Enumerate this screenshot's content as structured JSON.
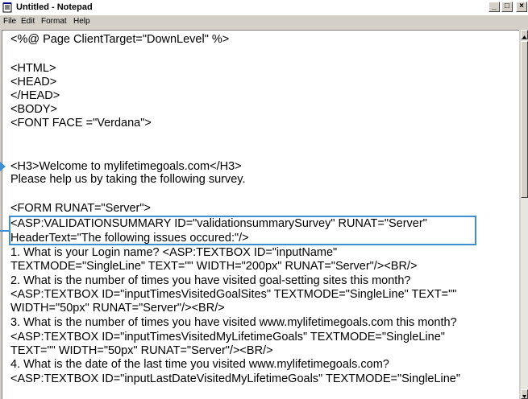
{
  "window": {
    "title": "Untitled - Notepad",
    "controls": {
      "minimize": "_",
      "maximize": "□",
      "close": "×"
    }
  },
  "menu": [
    "File",
    "Edit",
    "Format",
    "Help"
  ],
  "editor": {
    "lines": [
      "<%@ Page ClientTarget=\"DownLevel\" %>",
      "",
      "<HTML>",
      "<HEAD>",
      "</HEAD>",
      "<BODY>",
      "<FONT FACE =\"Verdana\">",
      "",
      "<H3>Welcome to mylifetimegoals.com</H3>",
      "Please help us by taking the following survey.",
      "",
      "<FORM RUNAT=\"Server\">",
      "<ASP:VALIDATIONSUMMARY ID=\"validationsummarySurvey\" RUNAT=\"Server\"",
      "HeaderText=\"The following issues occured:\"/>",
      "1. What is your Login name? <ASP:TEXTBOX ID=\"inputName\"",
      "TEXTMODE=\"SingleLine\" TEXT=\"\" WIDTH=\"200px\" RUNAT=\"Server\"/><BR/>",
      "2. What is the number of times you have visited goal-setting sites this month?",
      "<ASP:TEXTBOX ID=\"inputTimesVisitedGoalSites\" TEXTMODE=\"SingleLine\" TEXT=\"\"",
      "WIDTH=\"50px\" RUNAT=\"Server\"/><BR/>",
      "3. What is the number of times you have visited www.mylifetimegoals.com this month?",
      "<ASP:TEXTBOX ID=\"inputTimesVisitedMyLifetimeGoals\" TEXTMODE=\"SingleLine\"",
      "TEXT=\"\" WIDTH=\"50px\" RUNAT=\"Server\"/><BR/>",
      "4. What is the date of the last time you visited www.mylifetimegoals.com?",
      "<ASP:TEXTBOX ID=\"inputLastDateVisitedMyLifetimeGoals\" TEXTMODE=\"SingleLine\""
    ]
  },
  "colors": {
    "highlight": "#3d8ed3",
    "chrome": "#d4d0c8"
  },
  "icons": [
    "notepad-icon",
    "scroll-up-arrow-icon",
    "scroll-down-arrow-icon"
  ]
}
